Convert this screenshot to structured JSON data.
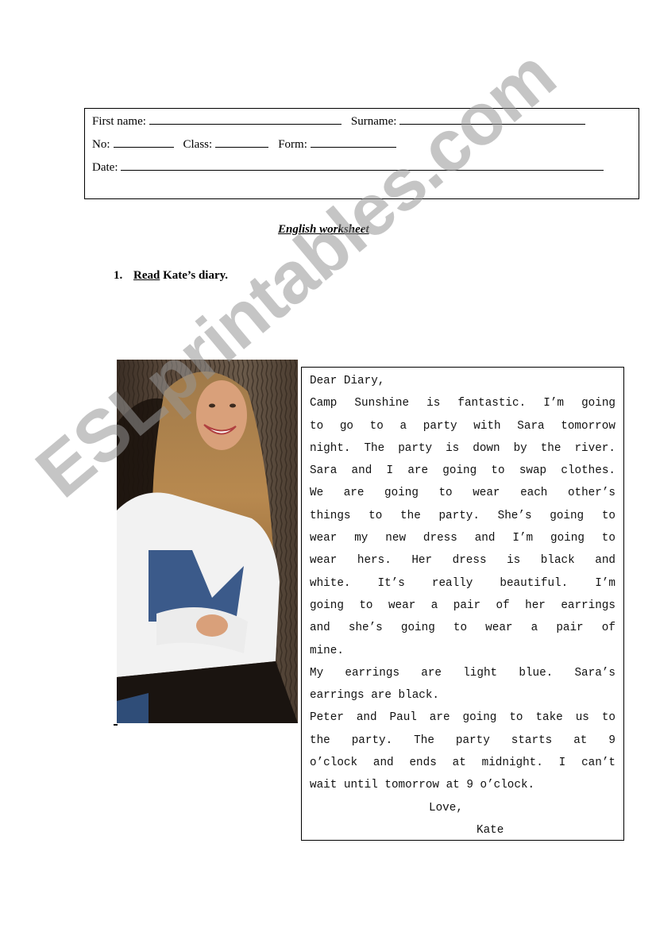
{
  "header_form": {
    "first_name_label": "First name:",
    "surname_label": "Surname:",
    "no_label": "No:",
    "class_label": "Class:",
    "form_label": "Form:",
    "date_label": "Date:",
    "first_name_value": "",
    "surname_value": "",
    "no_value": "",
    "class_value": "",
    "form_value": "",
    "date_value": ""
  },
  "title": "English worksheet",
  "exercise": {
    "number": "1.",
    "verb": "Read",
    "rest": " Kate’s diary."
  },
  "photo": {
    "icon": "photo-girl-by-tree",
    "description": "Smiling girl with long hair in white shirt and denim vest leaning against a tree"
  },
  "diary": {
    "lines": [
      "Dear Diary,",
      "Camp Sunshine is fantastic. I’m going",
      "to go to a party with Sara tomorrow",
      "night. The party is down by the river.",
      "Sara and I are going to swap clothes.",
      "We are going to wear each other’s",
      "things to the party. She’s going to",
      "wear my new dress and I’m going to",
      "wear hers. Her dress is black and",
      "white. It’s really beautiful. I’m",
      "going to wear a pair of her earrings",
      "and she’s going to wear a pair of",
      "mine.",
      "My earrings are light blue. Sara’s",
      "earrings are black.",
      "Peter and Paul are going to take us to",
      "the party. The party starts at 9",
      "o’clock and ends at midnight. I can’t",
      "wait until tomorrow at 9 o’clock."
    ],
    "closing": "Love,",
    "signature": "Kate"
  },
  "watermark": "ESLprintables.com"
}
